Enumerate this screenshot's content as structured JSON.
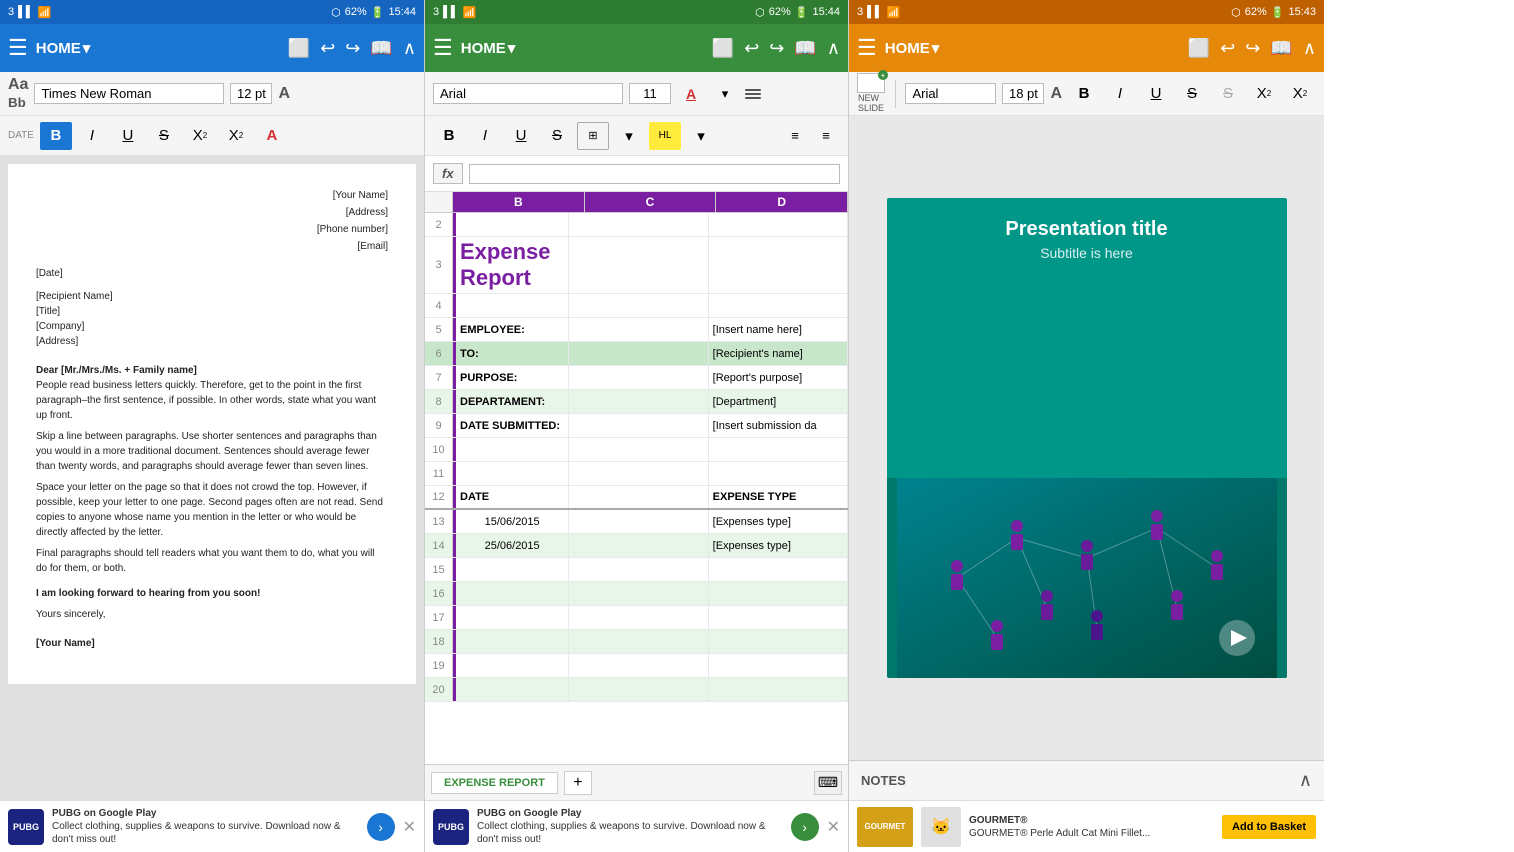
{
  "word": {
    "statusBar": {
      "left": "3",
      "signal": "▌▌▌",
      "wifi": "WiFi",
      "bluetooth": "B",
      "battery": "62%",
      "time": "15:44"
    },
    "toolbar": {
      "menu": "☰",
      "home": "HOME",
      "homeDropdown": "▾",
      "icons": [
        "⬜",
        "↩",
        "↪",
        "📖",
        "∧"
      ]
    },
    "formatBar": {
      "fontName": "Times New Roman",
      "fontSize": "12 pt",
      "formatA": "A"
    },
    "dateLabel": "DATE",
    "formatBtns": [
      "B",
      "I",
      "U",
      "S",
      "X₂",
      "X²",
      "A"
    ],
    "document": {
      "recipientName": "[Your Name]",
      "address": "[Address]",
      "phone": "[Phone number]",
      "email": "[Email]",
      "date": "[Date]",
      "recipientFull": "[Recipient Name]",
      "title": "[Title]",
      "company": "[Company]",
      "recipientAddress": "[Address]",
      "greeting": "Dear [Mr./Mrs./Ms. + Family name]",
      "para1": "People read business letters quickly. Therefore, get to the point in the first paragraph–the first sentence, if possible. In other words, state what you want up front.",
      "para2": "Skip a line between paragraphs. Use shorter sentences and paragraphs than you would in a more traditional document. Sentences should average fewer than twenty words, and paragraphs should average fewer than seven lines.",
      "para3": "Space your letter on the page so that it does not crowd the top. However, if possible, keep your letter to one page. Second pages often are not read. Send copies to anyone whose name you mention in the letter or who would be directly affected by the letter.",
      "para4": "Final paragraphs should tell readers what you want them to do, what you will do for them, or both.",
      "closing1": "I am looking forward to hearing from you soon!",
      "closing2": "Yours sincerely,",
      "yourName": "[Your Name]"
    },
    "ad": {
      "gameName": "PUBG on Google Play",
      "adText": "Collect clothing, supplies & weapons to survive. Download now & don't miss out!",
      "arrowLabel": "›"
    }
  },
  "excel": {
    "statusBar": {
      "left": "3",
      "signal": "▌▌▌",
      "wifi": "WiFi",
      "bluetooth": "B",
      "battery": "62%",
      "time": "15:44"
    },
    "toolbar": {
      "menu": "☰",
      "home": "HOME",
      "homeDropdown": "▾"
    },
    "formatBar": {
      "fontName": "Arial",
      "fontSize": "11",
      "fontColorBtn": "A",
      "alignBtn": "≡"
    },
    "fxBar": {
      "label": "fx"
    },
    "columns": [
      "B",
      "C",
      "D"
    ],
    "spreadsheet": {
      "title": "Expense Report",
      "rows": [
        {
          "num": "2",
          "cells": [
            "",
            "",
            ""
          ]
        },
        {
          "num": "3",
          "cells": [
            "Expense Report",
            "",
            ""
          ]
        },
        {
          "num": "4",
          "cells": [
            "",
            "",
            ""
          ]
        },
        {
          "num": "5",
          "cells": [
            "EMPLOYEE:",
            "",
            "[Insert name here]"
          ]
        },
        {
          "num": "6",
          "cells": [
            "TO:",
            "",
            "[Recipient's name]"
          ]
        },
        {
          "num": "7",
          "cells": [
            "PURPOSE:",
            "",
            "[Report's purpose]"
          ]
        },
        {
          "num": "8",
          "cells": [
            "DEPARTAMENT:",
            "",
            "[Department]"
          ]
        },
        {
          "num": "9",
          "cells": [
            "DATE SUBMITTED:",
            "",
            "[Insert submission da"
          ]
        },
        {
          "num": "10",
          "cells": [
            "",
            "",
            ""
          ]
        },
        {
          "num": "11",
          "cells": [
            "",
            "",
            ""
          ]
        },
        {
          "num": "12",
          "cells": [
            "DATE",
            "",
            "EXPENSE TYPE"
          ]
        },
        {
          "num": "13",
          "cells": [
            "15/06/2015",
            "",
            "[Expenses type]"
          ]
        },
        {
          "num": "14",
          "cells": [
            "25/06/2015",
            "",
            "[Expenses type]"
          ]
        },
        {
          "num": "15",
          "cells": [
            "",
            "",
            ""
          ]
        },
        {
          "num": "16",
          "cells": [
            "",
            "",
            ""
          ]
        },
        {
          "num": "17",
          "cells": [
            "",
            "",
            ""
          ]
        },
        {
          "num": "18",
          "cells": [
            "",
            "",
            ""
          ]
        },
        {
          "num": "19",
          "cells": [
            "",
            "",
            ""
          ]
        },
        {
          "num": "20",
          "cells": [
            "",
            "",
            ""
          ]
        }
      ]
    },
    "sheetTabs": {
      "tabName": "EXPENSE REPORT",
      "addBtn": "+",
      "kbdBtn": "⌨"
    },
    "ad": {
      "gameName": "PUBG on Google Play",
      "adText": "Collect clothing, supplies & weapons to survive. Download now & don't miss out!",
      "arrowLabel": "›"
    }
  },
  "ppt": {
    "statusBar": {
      "left": "3",
      "signal": "▌▌▌",
      "wifi": "WiFi",
      "bluetooth": "B",
      "battery": "62%",
      "time": "15:43"
    },
    "toolbar": {
      "menu": "☰",
      "home": "HOME",
      "homeDropdown": "▾"
    },
    "formatBar": {
      "newSlideLabel": "NEW\nSLIDE",
      "fontName": "Arial",
      "fontSize": "18 pt"
    },
    "slide": {
      "title": "Presentation title",
      "subtitle": "Subtitle is here"
    },
    "notes": {
      "label": "NOTES",
      "expandBtn": "∧"
    },
    "ad": {
      "brand": "GOURMET®",
      "productName": "GOURMET® Perle Adult Cat Mini Fillet...",
      "ctaBtn": "Add to Basket"
    }
  }
}
